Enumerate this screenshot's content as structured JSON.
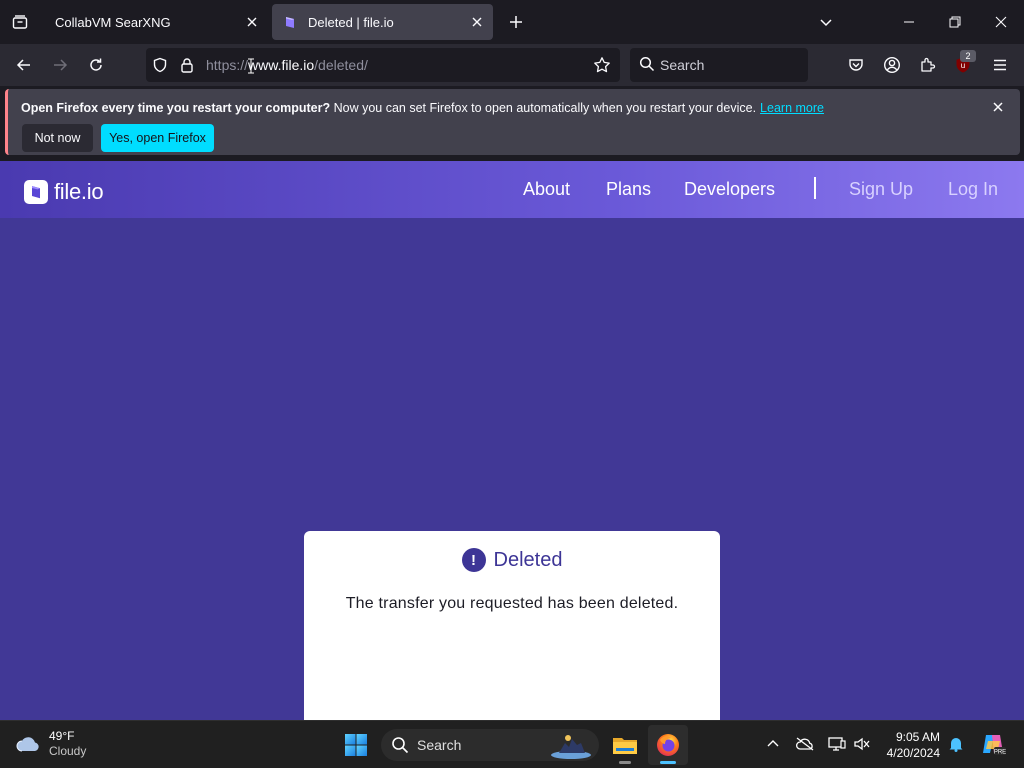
{
  "tabs": [
    {
      "title": "CollabVM SearXNG",
      "active": false
    },
    {
      "title": "Deleted | file.io",
      "active": true
    }
  ],
  "navbar": {
    "url_prefix": "https://",
    "url_host": "www.file.io",
    "url_path": "/deleted/",
    "search_placeholder": "Search",
    "extension_badge": "2"
  },
  "notification": {
    "bold_text": "Open Firefox every time you restart your computer?",
    "text": "Now you can set Firefox to open automatically when you restart your device.",
    "link": "Learn more",
    "not_now": "Not now",
    "yes": "Yes, open Firefox"
  },
  "site": {
    "logo_text": "file.io",
    "nav": {
      "about": "About",
      "plans": "Plans",
      "developers": "Developers",
      "signup": "Sign Up",
      "login": "Log In"
    },
    "card": {
      "icon": "!",
      "title": "Deleted",
      "message": "The transfer you requested has been deleted."
    }
  },
  "taskbar": {
    "weather_temp": "49°F",
    "weather_desc": "Cloudy",
    "search_placeholder": "Search",
    "time": "9:05 AM",
    "date": "4/20/2024"
  },
  "colors": {
    "page_bg": "#413896",
    "accent_cyan": "#00ddff",
    "brand_purple": "#3d3596"
  },
  "icons": [
    "tab-list-icon",
    "tab-favicon-icon",
    "close-icon",
    "plus-icon",
    "chevron-down-icon",
    "minimize-icon",
    "restore-icon",
    "back-icon",
    "forward-icon",
    "reload-icon",
    "shield-icon",
    "lock-icon",
    "star-icon",
    "search-icon",
    "pocket-icon",
    "account-icon",
    "extensions-icon",
    "ublock-icon",
    "menu-icon",
    "windows-start-icon",
    "file-explorer-icon",
    "firefox-icon",
    "chevron-up-icon",
    "onedrive-icon",
    "display-icon",
    "volume-muted-icon",
    "bell-icon",
    "copilot-icon",
    "cloud-icon"
  ]
}
